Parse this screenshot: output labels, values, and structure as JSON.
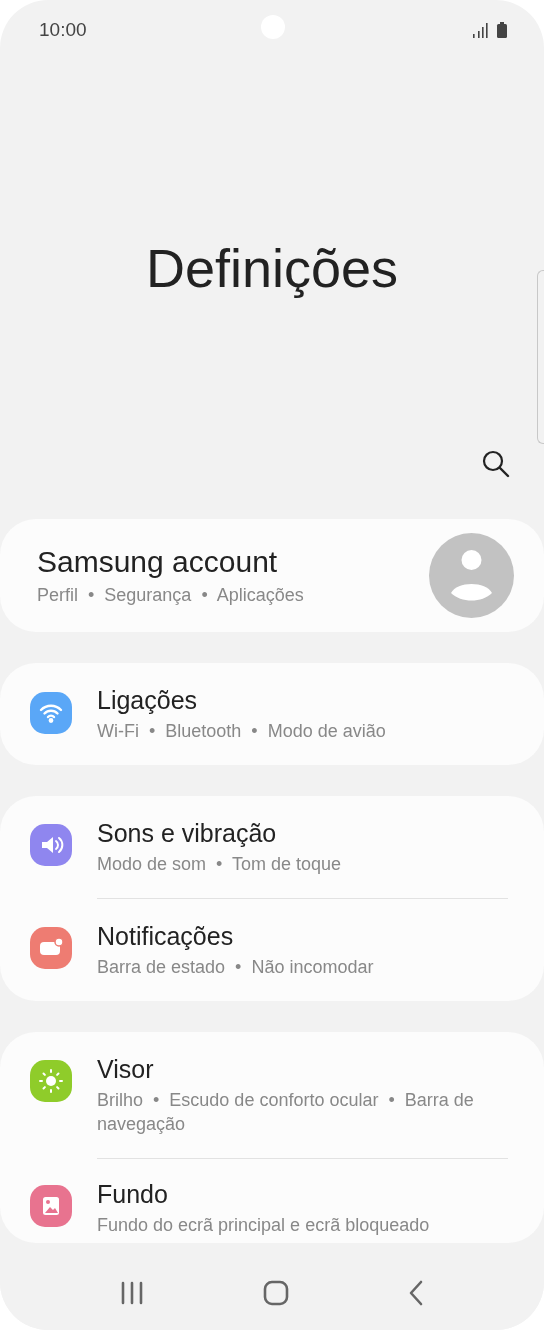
{
  "status_bar": {
    "time": "10:00"
  },
  "title": "Definições",
  "account": {
    "title": "Samsung account",
    "subtitle": "Perfil  •  Segurança  •  Aplicações"
  },
  "groups": [
    {
      "items": [
        {
          "title": "Ligações",
          "subtitle": "Wi-Fi  •  Bluetooth  •  Modo de avião",
          "color": "#5aa7f7"
        }
      ]
    },
    {
      "items": [
        {
          "title": "Sons e vibração",
          "subtitle": "Modo de som  •  Tom de toque",
          "color": "#8f86ef"
        },
        {
          "title": "Notificações",
          "subtitle": "Barra de estado  •  Não incomodar",
          "color": "#ee7c72"
        }
      ]
    },
    {
      "items": [
        {
          "title": "Visor",
          "subtitle": "Brilho  •  Escudo de conforto ocular  •  Barra de navegação",
          "color": "#8fcc2a"
        },
        {
          "title": "Fundo",
          "subtitle": "Fundo do ecrã principal e ecrã bloqueado",
          "color": "#e8738f"
        }
      ]
    }
  ]
}
